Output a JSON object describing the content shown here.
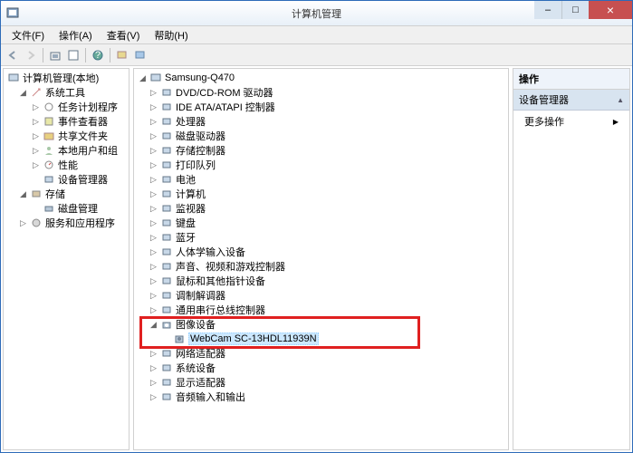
{
  "window": {
    "title": "计算机管理",
    "min": "–",
    "max": "□",
    "close": "×"
  },
  "menu": {
    "file": "文件(F)",
    "action": "操作(A)",
    "view": "查看(V)",
    "help": "帮助(H)"
  },
  "left_tree": {
    "root": "计算机管理(本地)",
    "system_tools": "系统工具",
    "task_scheduler": "任务计划程序",
    "event_viewer": "事件查看器",
    "shared_folders": "共享文件夹",
    "local_users": "本地用户和组",
    "performance": "性能",
    "device_manager": "设备管理器",
    "storage": "存储",
    "disk_mgmt": "磁盘管理",
    "services_apps": "服务和应用程序"
  },
  "mid_tree": {
    "root": "Samsung-Q470",
    "items": [
      {
        "label": "DVD/CD-ROM 驱动器",
        "expander": "▷"
      },
      {
        "label": "IDE ATA/ATAPI 控制器",
        "expander": "▷"
      },
      {
        "label": "处理器",
        "expander": "▷"
      },
      {
        "label": "磁盘驱动器",
        "expander": "▷"
      },
      {
        "label": "存储控制器",
        "expander": "▷"
      },
      {
        "label": "打印队列",
        "expander": "▷"
      },
      {
        "label": "电池",
        "expander": "▷"
      },
      {
        "label": "计算机",
        "expander": "▷"
      },
      {
        "label": "监视器",
        "expander": "▷"
      },
      {
        "label": "键盘",
        "expander": "▷"
      },
      {
        "label": "蓝牙",
        "expander": "▷"
      },
      {
        "label": "人体学输入设备",
        "expander": "▷"
      },
      {
        "label": "声音、视频和游戏控制器",
        "expander": "▷"
      },
      {
        "label": "鼠标和其他指针设备",
        "expander": "▷"
      },
      {
        "label": "调制解调器",
        "expander": "▷"
      },
      {
        "label": "通用串行总线控制器",
        "expander": "▷"
      }
    ],
    "imaging": {
      "label": "图像设备",
      "expander": "◢"
    },
    "webcam": "WebCam SC-13HDL11939N",
    "items2": [
      {
        "label": "网络适配器",
        "expander": "▷"
      },
      {
        "label": "系统设备",
        "expander": "▷"
      },
      {
        "label": "显示适配器",
        "expander": "▷"
      },
      {
        "label": "音频输入和输出",
        "expander": "▷"
      }
    ]
  },
  "right": {
    "header": "操作",
    "sub": "设备管理器",
    "more": "更多操作",
    "arrow_right": "▶",
    "arrow_up": "▲"
  }
}
